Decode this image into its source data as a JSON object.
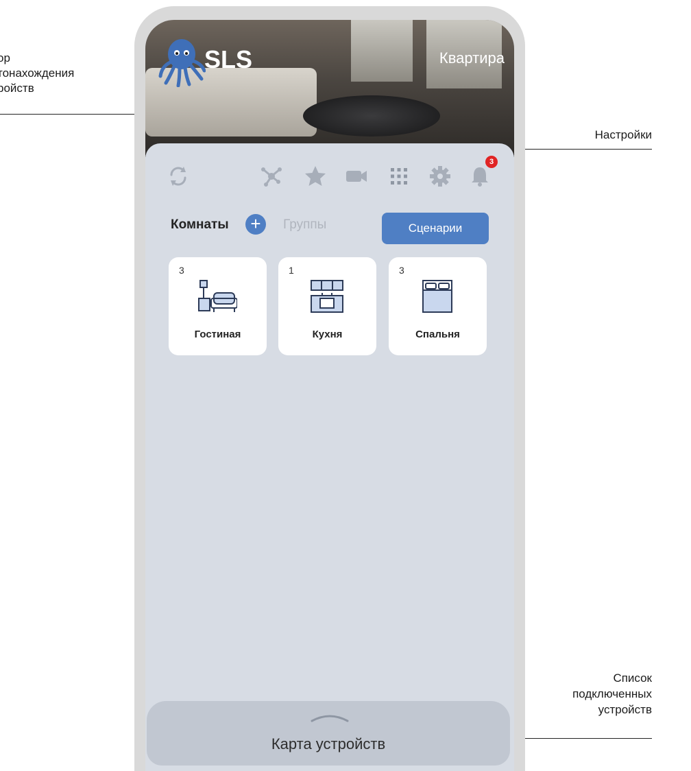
{
  "annotations": {
    "left_label": [
      "ор",
      "тонахождения",
      "ройств"
    ],
    "settings_label": "Настройки",
    "devices_list_label": [
      "Список",
      "подключенных",
      "устройств"
    ]
  },
  "header": {
    "brand": "SLS",
    "location": "Квартира"
  },
  "toolbar": {
    "icons": [
      "refresh-icon",
      "network-icon",
      "star-icon",
      "camera-icon",
      "grid-icon",
      "gear-icon",
      "bell-icon"
    ],
    "notification_count": "3"
  },
  "tabs": {
    "rooms": "Комнаты",
    "groups": "Группы",
    "scenarios": "Сценарии"
  },
  "rooms": [
    {
      "count": "3",
      "name": "Гостиная",
      "icon": "living-room-icon"
    },
    {
      "count": "1",
      "name": "Кухня",
      "icon": "kitchen-icon"
    },
    {
      "count": "3",
      "name": "Спальня",
      "icon": "bedroom-icon"
    }
  ],
  "drawer": {
    "label": "Карта устройств"
  },
  "colors": {
    "accent": "#4f7fc4",
    "badge": "#e02424",
    "panel": "#d7dce4",
    "frame": "#d9d9d9"
  }
}
